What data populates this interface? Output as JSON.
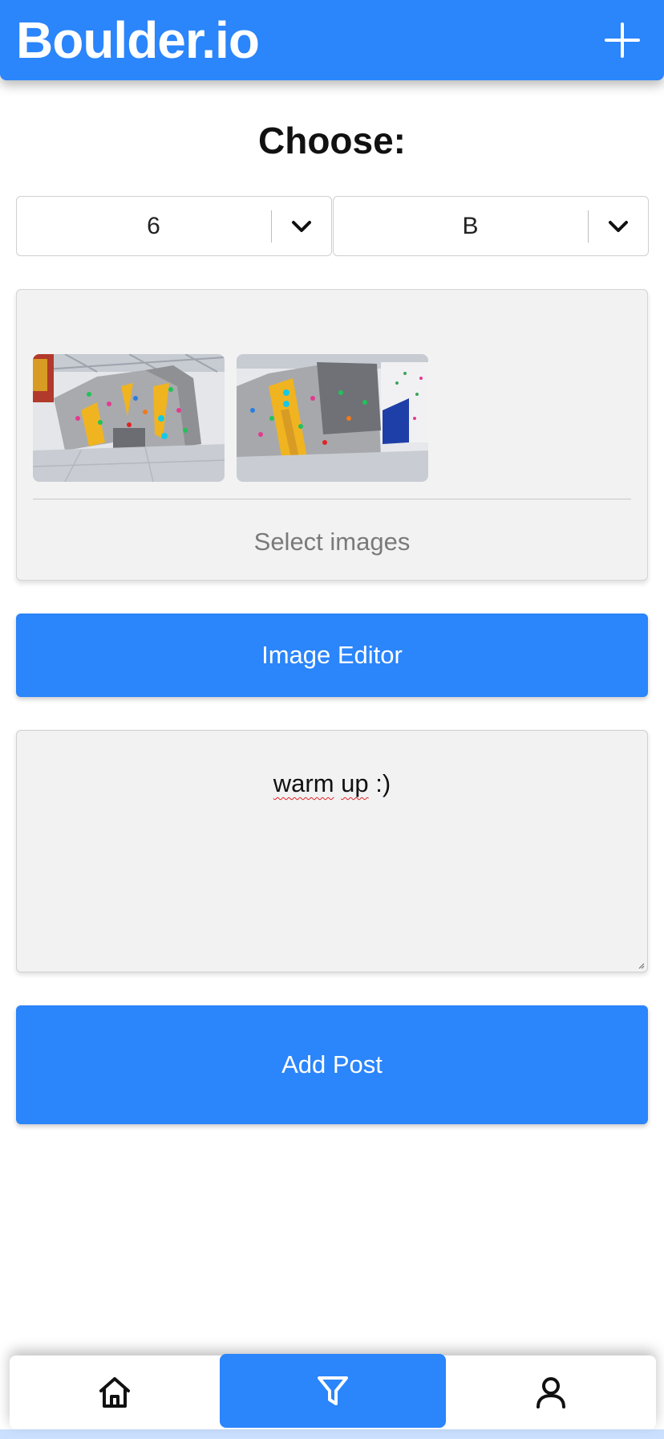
{
  "header": {
    "brand": "Boulder.io",
    "add_icon": "plus-icon"
  },
  "form": {
    "title": "Choose:",
    "grade_select": {
      "value": "6"
    },
    "letter_select": {
      "value": "B"
    },
    "images": {
      "select_label": "Select images",
      "thumbnails": [
        "climbing-wall-photo",
        "climbing-wall-photo"
      ]
    },
    "image_editor_label": "Image Editor",
    "description": {
      "value_word1": "warm",
      "value_word2": "up",
      "value_tail": " :)"
    },
    "add_post_label": "Add Post"
  },
  "nav": {
    "items": [
      {
        "icon": "home-icon"
      },
      {
        "icon": "filter-icon",
        "active": true
      },
      {
        "icon": "user-icon"
      }
    ]
  },
  "colors": {
    "primary": "#2b85fb",
    "card_bg": "#f2f2f2"
  }
}
